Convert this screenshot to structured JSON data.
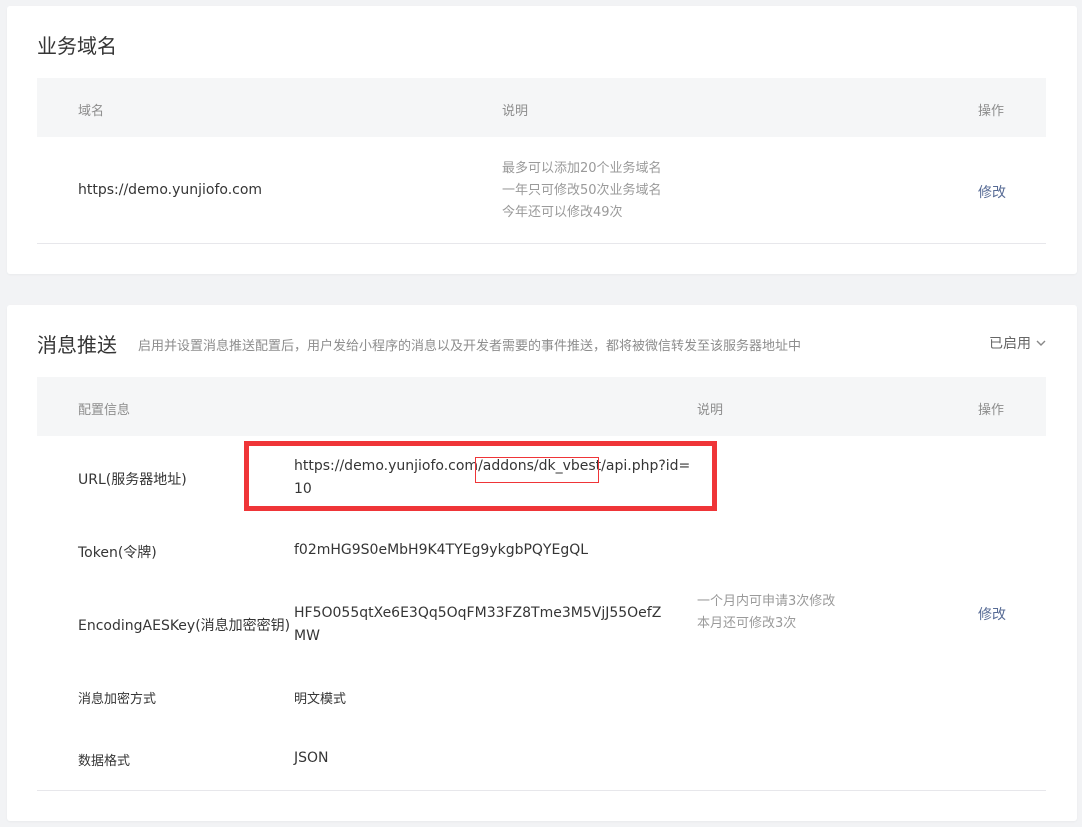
{
  "business_domain": {
    "title": "业务域名",
    "columns": {
      "domain": "域名",
      "desc": "说明",
      "action": "操作"
    },
    "row": {
      "domain": "https://demo.yunjiofo.com",
      "notes": [
        "最多可以添加20个业务域名",
        "一年只可修改50次业务域名",
        "今年还可以修改49次"
      ],
      "action": "修改"
    }
  },
  "message_push": {
    "title": "消息推送",
    "subtitle": "启用并设置消息推送配置后，用户发给小程序的消息以及开发者需要的事件推送，都将被微信转发至该服务器地址中",
    "status": "已启用",
    "columns": {
      "config": "配置信息",
      "desc": "说明",
      "action": "操作"
    },
    "url": {
      "label": "URL(服务器地址)",
      "line1_prefix": "https://demo.yunjiofo.com",
      "line1_highlight": "/addons/dk_vbest/",
      "line1_suffix": "api.php?id=",
      "line2": "10"
    },
    "token": {
      "label": "Token(令牌)",
      "value": "f02mHG9S0eMbH9K4TYEg9ykgbPQYEgQL"
    },
    "aes": {
      "label": "EncodingAESKey(消息加密密钥)",
      "line1": "HF5O055qtXe6E3Qq5OqFM33FZ8Tme3M5VjJ55OefZ",
      "line2": "MW",
      "notes": [
        "一个月内可申请3次修改",
        "本月还可修改3次"
      ],
      "action": "修改"
    },
    "encrypt": {
      "label": "消息加密方式",
      "value": "明文模式"
    },
    "format": {
      "label": "数据格式",
      "value": "JSON"
    }
  },
  "colors": {
    "accent_link": "#576b95",
    "highlight": "#ef3538"
  }
}
